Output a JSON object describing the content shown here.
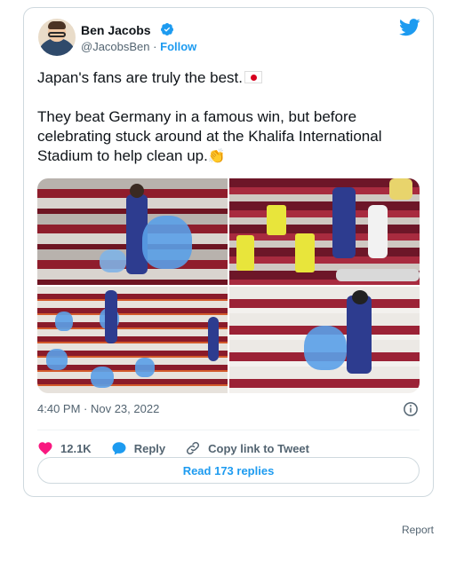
{
  "tweet": {
    "author": {
      "name": "Ben Jacobs",
      "handle": "@JacobsBen",
      "separator": "·",
      "follow_label": "Follow"
    },
    "text_line1": "Japan's fans are truly the best.",
    "text_line2": "They beat Germany in a famous win, but before celebrating stuck around at the Khalifa International Stadium to help clean up.",
    "emoji_flag": "japan-flag",
    "emoji_clap": "👏",
    "timestamp": "4:40 PM · Nov 23, 2022",
    "actions": {
      "like_count": "12.1K",
      "reply_label": "Reply",
      "copy_link_label": "Copy link to Tweet"
    },
    "read_replies_label": "Read 173 replies"
  },
  "footer": {
    "report_label": "Report"
  },
  "colors": {
    "accent": "#1d9bf0",
    "like": "#f91880",
    "text": "#0f1419",
    "muted": "#536471",
    "border": "#cfd9de"
  },
  "icons": [
    "verified-badge-icon",
    "twitter-bird-icon",
    "info-icon",
    "heart-icon",
    "reply-bubble-icon",
    "link-icon"
  ]
}
